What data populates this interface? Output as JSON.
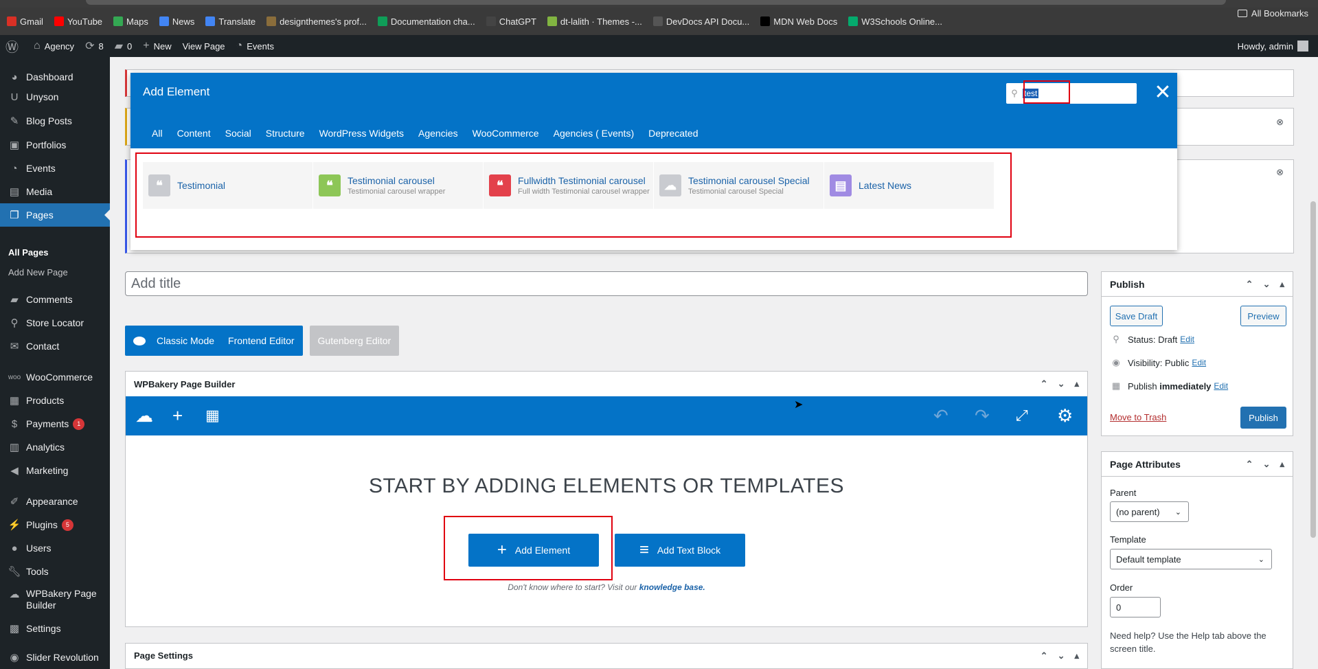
{
  "bookmarks": [
    {
      "label": "Gmail",
      "icon": "gmail-icon",
      "color": "#d93025"
    },
    {
      "label": "YouTube",
      "icon": "youtube-icon",
      "color": "#ff0000"
    },
    {
      "label": "Maps",
      "icon": "maps-icon",
      "color": "#34a853"
    },
    {
      "label": "News",
      "icon": "news-icon",
      "color": "#4285f4"
    },
    {
      "label": "Translate",
      "icon": "translate-icon",
      "color": "#4285f4"
    },
    {
      "label": "designthemes's prof...",
      "icon": "designthemes-icon",
      "color": "#8a6d3b"
    },
    {
      "label": "Documentation cha...",
      "icon": "sheets-icon",
      "color": "#0f9d58"
    },
    {
      "label": "ChatGPT",
      "icon": "chatgpt-icon",
      "color": "#444444"
    },
    {
      "label": "dt-lalith · Themes -...",
      "icon": "envato-icon",
      "color": "#81b441"
    },
    {
      "label": "DevDocs API Docu...",
      "icon": "devdocs-icon",
      "color": "#555555"
    },
    {
      "label": "MDN Web Docs",
      "icon": "mdn-icon",
      "color": "#000000"
    },
    {
      "label": "W3Schools Online...",
      "icon": "w3schools-icon",
      "color": "#04aa6d"
    }
  ],
  "all_bookmarks": "All Bookmarks",
  "adminbar": {
    "site": "Agency",
    "updates": "8",
    "comments": "0",
    "new": "New",
    "view_page": "View Page",
    "events": "Events",
    "howdy": "Howdy, admin"
  },
  "sidebar": {
    "dashboard": "Dashboard",
    "unyson": "Unyson",
    "blog_posts": "Blog Posts",
    "portfolios": "Portfolios",
    "events": "Events",
    "media": "Media",
    "pages": "Pages",
    "all_pages": "All Pages",
    "add_new_page": "Add New Page",
    "comments": "Comments",
    "store_locator": "Store Locator",
    "contact": "Contact",
    "woocommerce": "WooCommerce",
    "products": "Products",
    "payments": "Payments",
    "payments_badge": "1",
    "analytics": "Analytics",
    "marketing": "Marketing",
    "appearance": "Appearance",
    "plugins": "Plugins",
    "plugins_badge": "5",
    "users": "Users",
    "tools": "Tools",
    "wpbakery_line1": "WPBakery Page",
    "wpbakery_line2": "Builder",
    "settings": "Settings",
    "slider_revolution": "Slider Revolution"
  },
  "modal": {
    "title": "Add Element",
    "search_value": "test",
    "tabs": [
      "All",
      "Content",
      "Social",
      "Structure",
      "WordPress Widgets",
      "Agencies",
      "WooCommerce",
      "Agencies ( Events)",
      "Deprecated"
    ],
    "results": [
      {
        "title": "Testimonial",
        "desc": "",
        "icon": "quote-icon",
        "color": "#c9cbd0"
      },
      {
        "title": "Testimonial carousel",
        "desc": "Testimonial carousel wrapper",
        "icon": "quote-icon",
        "color": "#8dc657"
      },
      {
        "title": "Fullwidth Testimonial carousel",
        "desc": "Full width Testimonial carousel wrapper",
        "icon": "quote-carousel-icon",
        "color": "#e3414b"
      },
      {
        "title": "Testimonial carousel Special",
        "desc": "Testimonial carousel Special",
        "icon": "cloud-icon",
        "color": "#c9cbd0"
      },
      {
        "title": "Latest News",
        "desc": "",
        "icon": "news-grid-icon",
        "color": "#a08be3"
      }
    ]
  },
  "editor": {
    "title_placeholder": "Add title",
    "classic_mode": "Classic Mode",
    "frontend_editor": "Frontend Editor",
    "gutenberg_editor": "Gutenberg Editor"
  },
  "wpbakery": {
    "title": "WPBakery Page Builder",
    "start_text": "START BY ADDING ELEMENTS OR TEMPLATES",
    "add_element": "Add Element",
    "add_text_block": "Add Text Block",
    "hint_prefix": "Don't know where to start? Visit our",
    "hint_link": "knowledge base."
  },
  "page_settings": "Page Settings",
  "publish": {
    "title": "Publish",
    "save_draft": "Save Draft",
    "preview": "Preview",
    "status_label": "Status:",
    "status_value": "Draft",
    "visibility_label": "Visibility:",
    "visibility_value": "Public",
    "publish_label": "Publish",
    "publish_value": "immediately",
    "edit": "Edit",
    "move_to_trash": "Move to Trash",
    "publish_button": "Publish"
  },
  "attributes": {
    "title": "Page Attributes",
    "parent_label": "Parent",
    "parent_value": "(no parent)",
    "template_label": "Template",
    "template_value": "Default template",
    "order_label": "Order",
    "order_value": "0",
    "help": "Need help? Use the Help tab above the screen title."
  }
}
